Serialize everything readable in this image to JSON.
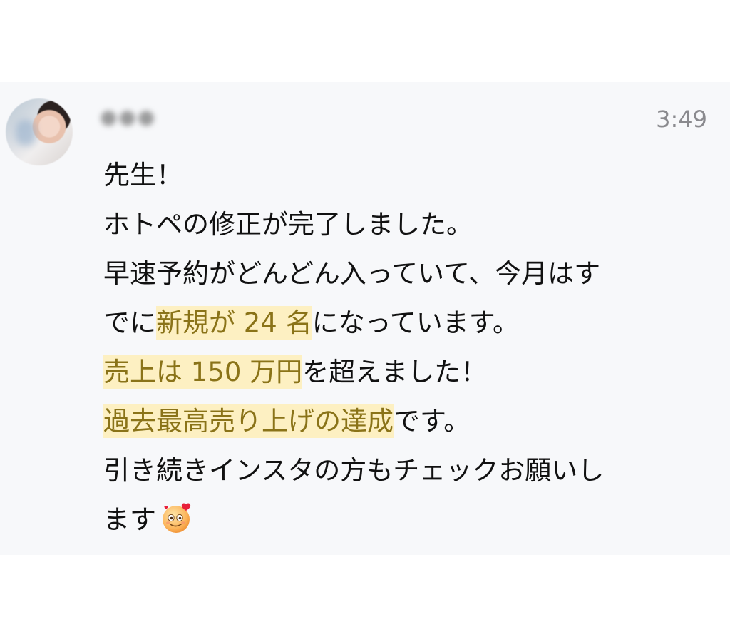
{
  "message": {
    "timestamp": "3:49",
    "sender_name": "●●●",
    "lines": {
      "l1": "先生！",
      "l2": "ホトペの修正が完了しました。",
      "l3": "早速予約がどんどん入っていて、今月はす",
      "l4_a": "でに",
      "l4_hl": "新規が 24 名",
      "l4_b": "になっています。",
      "l5_hl": "売上は 150 万円",
      "l5_b": "を超えました！",
      "l6_hl": "過去最高売り上げの達成",
      "l6_b": "です。",
      "l7": "引き続きインスタの方もチェックお願いし",
      "l8": "ます"
    },
    "emoji_icon": "smiling-face-with-heart-icon"
  },
  "colors": {
    "card_background": "#f7f8fa",
    "highlight_background": "#fdf0c2",
    "highlight_text": "#8a7318",
    "timestamp_text": "#8a8a8e"
  }
}
